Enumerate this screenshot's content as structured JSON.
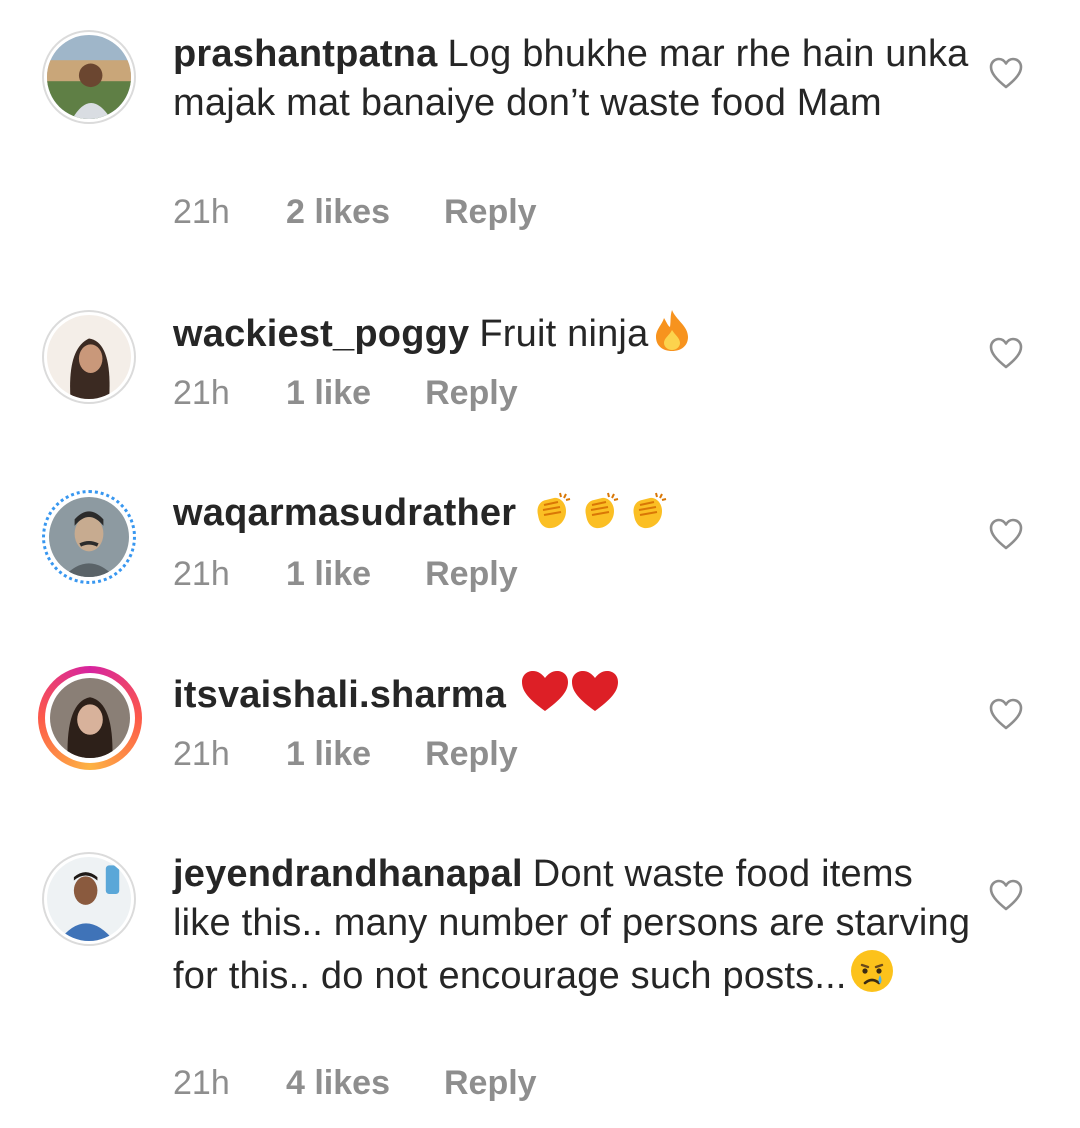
{
  "comments": [
    {
      "username": "prashantpatna",
      "text": "Log bhukhe mar rhe hain unka majak mat banaiye don’t waste food Mam",
      "time": "21h",
      "likes": "2 likes",
      "reply": "Reply",
      "emoji": []
    },
    {
      "username": "wackiest_poggy",
      "text": "Fruit ninja",
      "time": "21h",
      "likes": "1 like",
      "reply": "Reply",
      "emoji": [
        "fire"
      ]
    },
    {
      "username": "waqarmasudrather",
      "text": "",
      "time": "21h",
      "likes": "1 like",
      "reply": "Reply",
      "emoji": [
        "clapping-hands",
        "clapping-hands",
        "clapping-hands"
      ]
    },
    {
      "username": "itsvaishali.sharma",
      "text": "",
      "time": "21h",
      "likes": "1 like",
      "reply": "Reply",
      "emoji": [
        "red-heart",
        "red-heart"
      ]
    },
    {
      "username": "jeyendrandhanapal",
      "text": "Dont waste food items like this.. many number of persons are starving for this.. do not encourage such posts...",
      "time": "21h",
      "likes": "4 likes",
      "reply": "Reply",
      "emoji": [
        "crying-face"
      ]
    }
  ],
  "icons": {
    "like": "heart-outline-icon"
  },
  "colors": {
    "text": "#262626",
    "meta": "#8e8e8e",
    "heart_outline": "#8e8e8e"
  }
}
